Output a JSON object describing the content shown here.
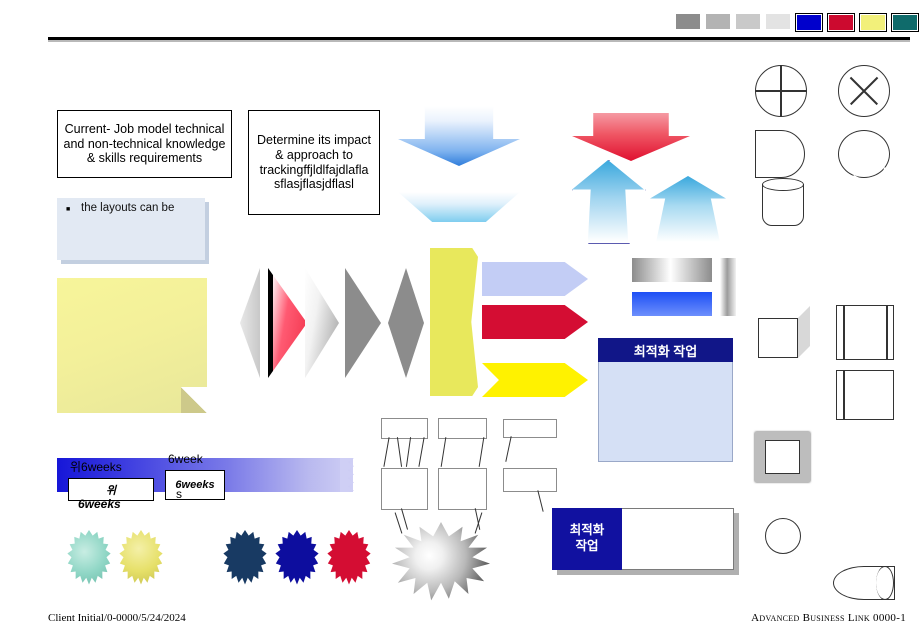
{
  "slide": {
    "title_bar": {
      "rule_color": "#000000"
    },
    "swatches": [
      {
        "name": "gray-1",
        "color": "#8c8c8c",
        "bordered": false
      },
      {
        "name": "gray-2",
        "color": "#b3b3b3",
        "bordered": false
      },
      {
        "name": "gray-3",
        "color": "#c9c9c9",
        "bordered": false
      },
      {
        "name": "gray-4",
        "color": "#e3e3e3",
        "bordered": false
      },
      {
        "name": "blue",
        "color": "#0000cc",
        "bordered": true
      },
      {
        "name": "crimson",
        "color": "#cc0a2f",
        "bordered": true
      },
      {
        "name": "yellow",
        "color": "#f2f07a",
        "bordered": true
      },
      {
        "name": "teal",
        "color": "#0f6b6b",
        "bordered": true
      }
    ]
  },
  "text_boxes": {
    "current_job_model": "Current- Job model technical and non-technical knowledge & skills requirements",
    "determine_impact": "Determine its impact & approach to trackingffjldlfajdlafla sflasjflasjdflasl"
  },
  "blue_box": {
    "bullet": "■",
    "text": "the layouts can be"
  },
  "ribbon": {
    "label_top_left": "위6weeks",
    "label_top_mid": "6week",
    "tag_left": "위",
    "tag_mid": "6weeks",
    "label_bottom_left": "6weeks",
    "label_mid_overlay": "6week",
    "label_mid_overlay2": "s"
  },
  "korean_panel": {
    "header": "최적화 작업"
  },
  "korean_panel2": {
    "line1": "최적화",
    "line2": "작업"
  },
  "chevrons": [
    {
      "name": "chevron-lightblue",
      "color": "#c3cdf5"
    },
    {
      "name": "chevron-crimson",
      "color": "#d40d33"
    },
    {
      "name": "chevron-yellow",
      "color": "#fff200"
    }
  ],
  "bursts": [
    {
      "name": "burst-teal",
      "color": "#79cdbd"
    },
    {
      "name": "burst-yellow",
      "color": "#e3df66"
    },
    {
      "name": "burst-white",
      "color": "#ffffff"
    },
    {
      "name": "burst-navy",
      "color": "#183a63"
    },
    {
      "name": "burst-blue",
      "color": "#0d0d9e"
    },
    {
      "name": "burst-red",
      "color": "#d40d33"
    }
  ],
  "shapes_right": [
    "summing-junction-icon",
    "circle-x-icon",
    "delay-d-icon",
    "q-shape-icon",
    "cylinder-icon",
    "lightning-bolt-icon",
    "four-point-star-icon",
    "cut-corner-rectangle-icon",
    "cube-icon",
    "framed-rectangle-icon",
    "folded-corner-icon",
    "side-bars-rectangle-icon",
    "beveled-frame-icon",
    "wave-bottom-icon",
    "sun-burst-icon",
    "double-wave-icon",
    "rolled-tape-icon"
  ],
  "footer": {
    "left": "Client Initial/0-0000/5/24/2024",
    "right": "Advanced Business Link  0000-1"
  }
}
